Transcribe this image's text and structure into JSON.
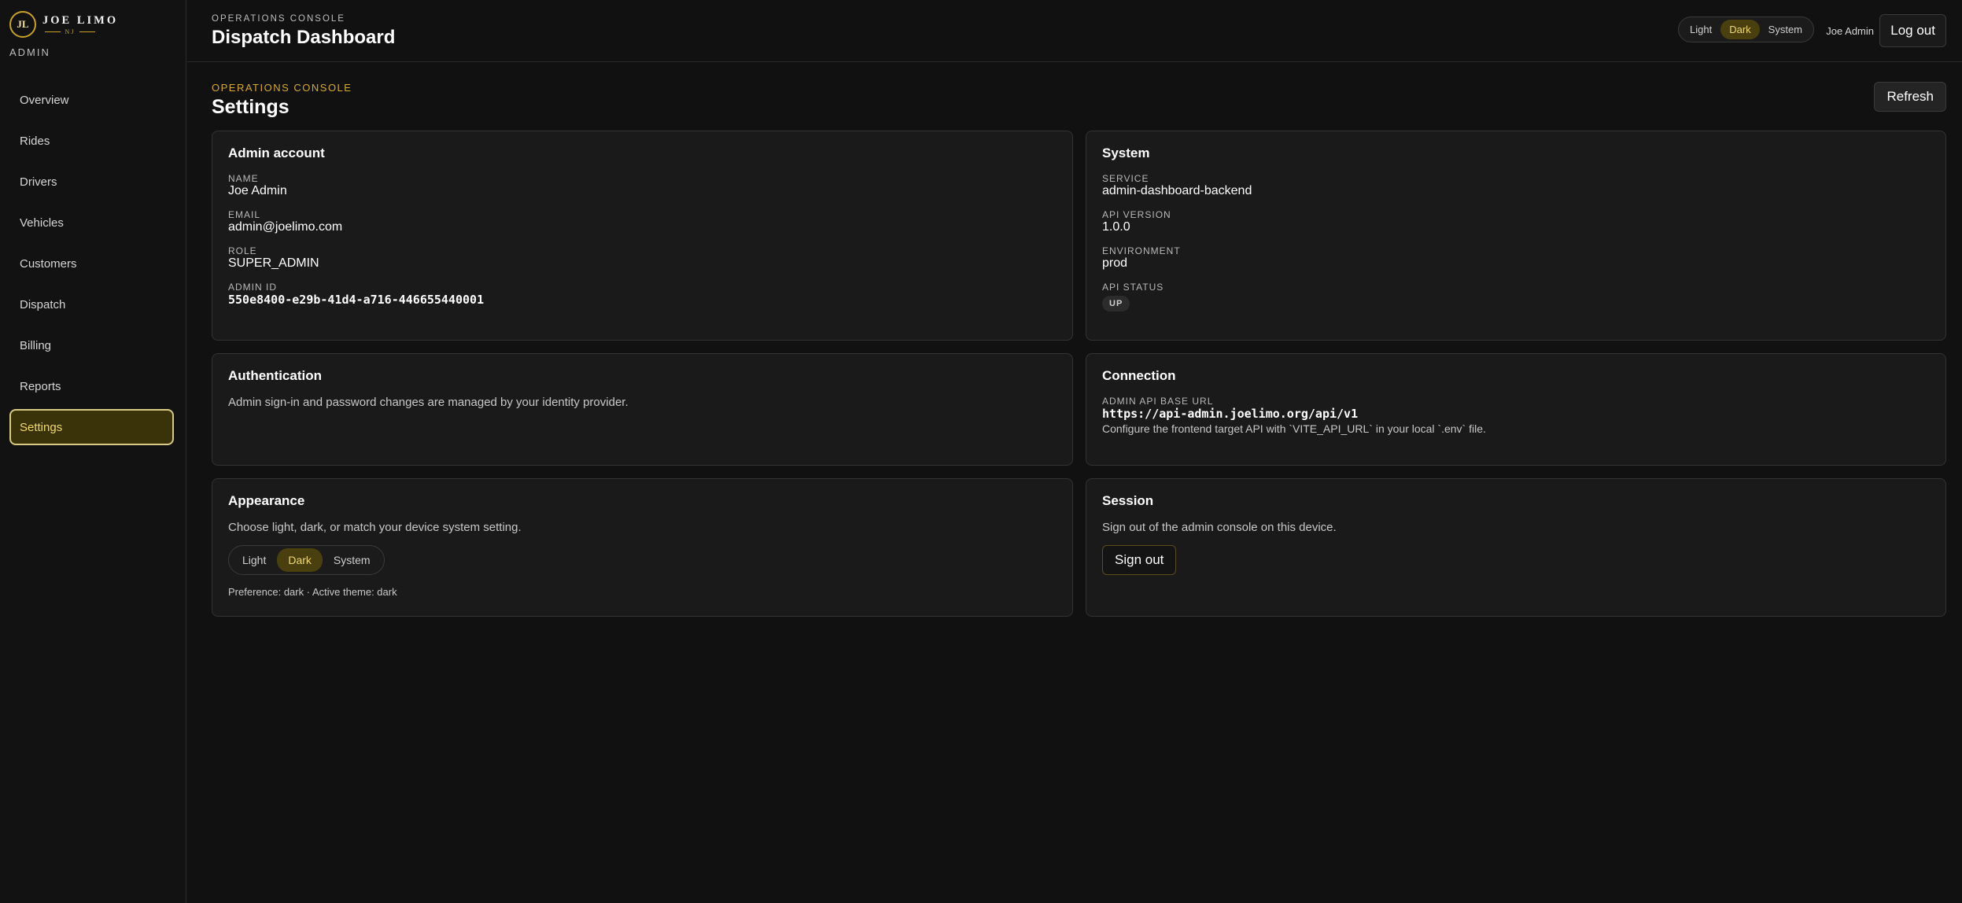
{
  "brand": {
    "logo_initials": "JL",
    "name": "JOE LIMO",
    "sub": "NJ",
    "section": "ADMIN"
  },
  "sidebar": {
    "items": [
      {
        "label": "Overview"
      },
      {
        "label": "Rides"
      },
      {
        "label": "Drivers"
      },
      {
        "label": "Vehicles"
      },
      {
        "label": "Customers"
      },
      {
        "label": "Dispatch"
      },
      {
        "label": "Billing"
      },
      {
        "label": "Reports"
      },
      {
        "label": "Settings",
        "active": true
      }
    ]
  },
  "header": {
    "eyebrow": "OPERATIONS CONSOLE",
    "title": "Dispatch Dashboard",
    "theme_options": [
      "Light",
      "Dark",
      "System"
    ],
    "theme_selected": "Dark",
    "user_name": "Joe Admin",
    "logout_label": "Log out"
  },
  "page": {
    "eyebrow": "OPERATIONS CONSOLE",
    "title": "Settings",
    "refresh_label": "Refresh"
  },
  "admin_account": {
    "title": "Admin account",
    "fields": [
      {
        "label": "NAME",
        "value": "Joe Admin"
      },
      {
        "label": "EMAIL",
        "value": "admin@joelimo.com"
      },
      {
        "label": "ROLE",
        "value": "SUPER_ADMIN"
      },
      {
        "label": "ADMIN ID",
        "value": "550e8400-e29b-41d4-a716-446655440001"
      }
    ]
  },
  "system": {
    "title": "System",
    "fields": [
      {
        "label": "SERVICE",
        "value": "admin-dashboard-backend"
      },
      {
        "label": "API VERSION",
        "value": "1.0.0"
      },
      {
        "label": "ENVIRONMENT",
        "value": "prod"
      },
      {
        "label": "API STATUS",
        "value": "UP"
      }
    ]
  },
  "authentication": {
    "title": "Authentication",
    "text": "Admin sign-in and password changes are managed by your identity provider."
  },
  "connection": {
    "title": "Connection",
    "label": "ADMIN API BASE URL",
    "url": "https://api-admin.joelimo.org/api/v1",
    "hint": "Configure the frontend target API with `VITE_API_URL` in your local `.env` file."
  },
  "appearance": {
    "title": "Appearance",
    "text": "Choose light, dark, or match your device system setting.",
    "options": [
      "Light",
      "Dark",
      "System"
    ],
    "selected": "Dark",
    "status": "Preference: dark · Active theme: dark"
  },
  "session": {
    "title": "Session",
    "text": "Sign out of the admin console on this device.",
    "button_label": "Sign out"
  },
  "colors": {
    "background": "#111111",
    "card": "#1a1a1a",
    "accent_gold": "#d7aa2b",
    "active_nav_bg": "#3a3208"
  }
}
